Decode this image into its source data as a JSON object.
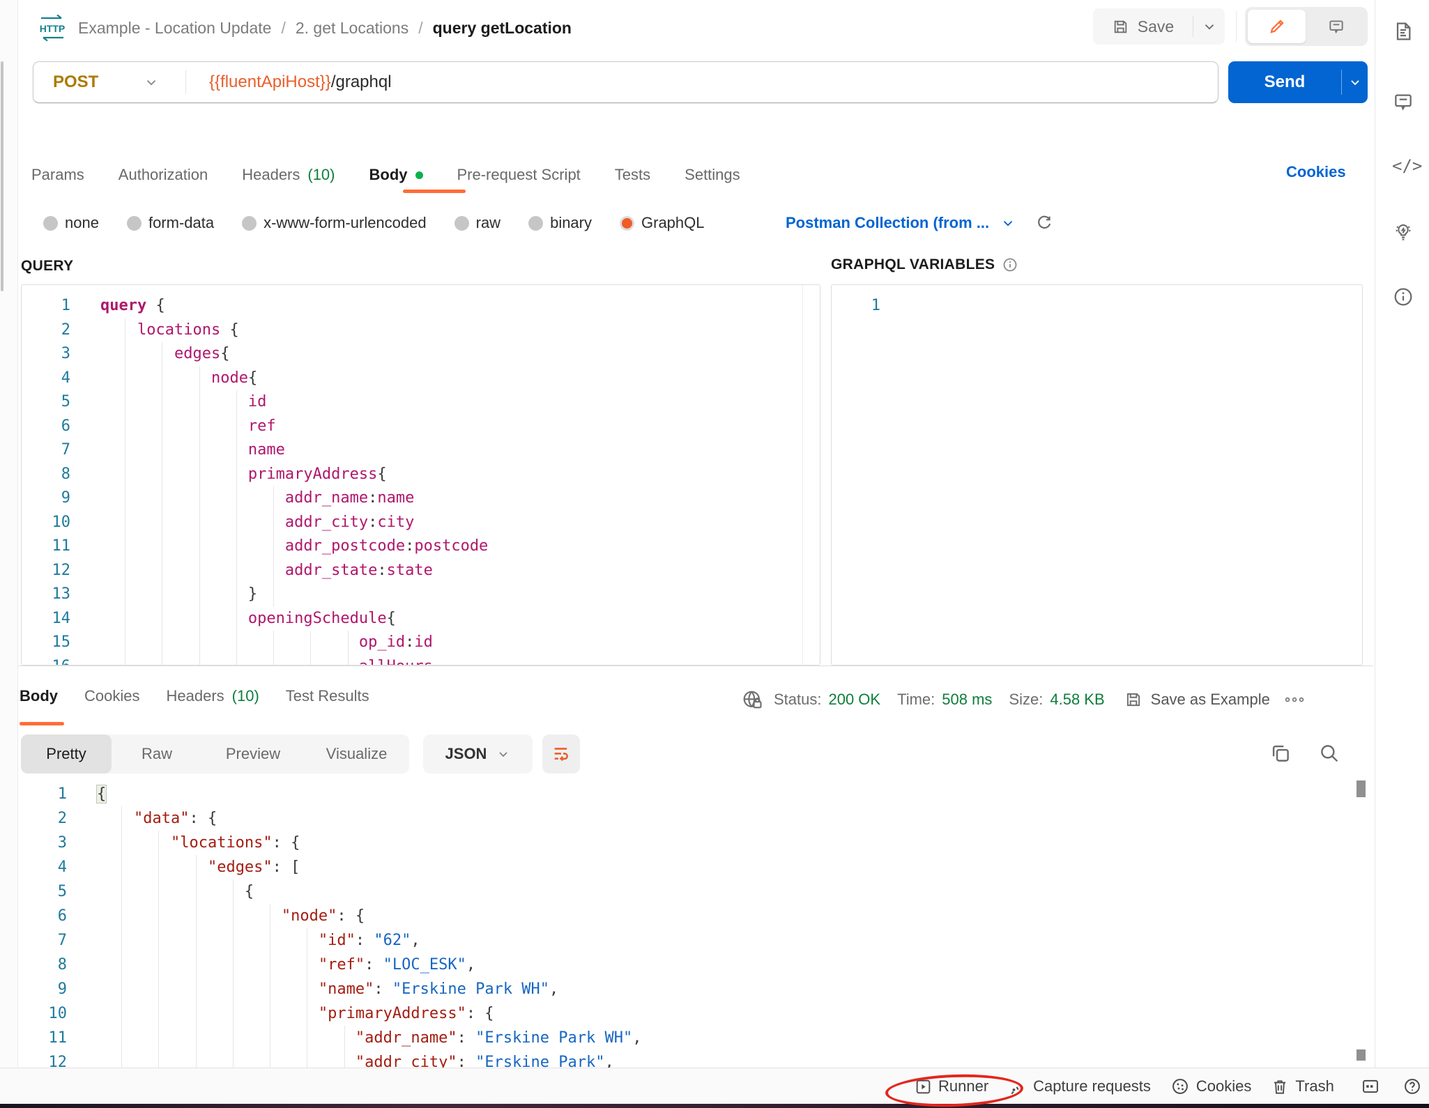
{
  "header": {
    "badge": "HTTP",
    "breadcrumb": [
      "Example - Location Update",
      "2. get Locations",
      "query getLocation"
    ],
    "save": "Save"
  },
  "request": {
    "method": "POST",
    "url_var": "{{fluentApiHost}}",
    "url_path": "/graphql",
    "send": "Send"
  },
  "tabs": {
    "items": [
      {
        "label": "Params"
      },
      {
        "label": "Authorization"
      },
      {
        "label": "Headers",
        "count": "(10)"
      },
      {
        "label": "Body",
        "active": true,
        "dot": true
      },
      {
        "label": "Pre-request Script"
      },
      {
        "label": "Tests"
      },
      {
        "label": "Settings"
      }
    ],
    "cookies": "Cookies"
  },
  "body_modes": {
    "options": [
      "none",
      "form-data",
      "x-www-form-urlencoded",
      "raw",
      "binary",
      "GraphQL"
    ],
    "selected": "GraphQL",
    "schema": "Postman Collection (from ..."
  },
  "query": {
    "label": "QUERY",
    "lines": [
      [
        [
          "kw",
          "query"
        ],
        [
          "pt",
          " {"
        ]
      ],
      [
        [
          "pt",
          "    "
        ],
        [
          "nm",
          "locations"
        ],
        [
          "pt",
          " {"
        ]
      ],
      [
        [
          "pt",
          "        "
        ],
        [
          "nm",
          "edges"
        ],
        [
          "pt",
          "{"
        ]
      ],
      [
        [
          "pt",
          "            "
        ],
        [
          "nm",
          "node"
        ],
        [
          "pt",
          "{"
        ]
      ],
      [
        [
          "pt",
          "                "
        ],
        [
          "nm",
          "id"
        ]
      ],
      [
        [
          "pt",
          "                "
        ],
        [
          "nm",
          "ref"
        ]
      ],
      [
        [
          "pt",
          "                "
        ],
        [
          "nm",
          "name"
        ]
      ],
      [
        [
          "pt",
          "                "
        ],
        [
          "nm",
          "primaryAddress"
        ],
        [
          "pt",
          "{"
        ]
      ],
      [
        [
          "pt",
          "                    "
        ],
        [
          "nm",
          "addr_name"
        ],
        [
          "pt",
          ":"
        ],
        [
          "nm",
          "name"
        ]
      ],
      [
        [
          "pt",
          "                    "
        ],
        [
          "nm",
          "addr_city"
        ],
        [
          "pt",
          ":"
        ],
        [
          "nm",
          "city"
        ]
      ],
      [
        [
          "pt",
          "                    "
        ],
        [
          "nm",
          "addr_postcode"
        ],
        [
          "pt",
          ":"
        ],
        [
          "nm",
          "postcode"
        ]
      ],
      [
        [
          "pt",
          "                    "
        ],
        [
          "nm",
          "addr_state"
        ],
        [
          "pt",
          ":"
        ],
        [
          "nm",
          "state"
        ]
      ],
      [
        [
          "pt",
          "                "
        ],
        [
          "pt",
          "}"
        ]
      ],
      [
        [
          "pt",
          "                "
        ],
        [
          "nm",
          "openingSchedule"
        ],
        [
          "pt",
          "{"
        ]
      ],
      [
        [
          "pt",
          "                            "
        ],
        [
          "nm",
          "op_id"
        ],
        [
          "pt",
          ":"
        ],
        [
          "nm",
          "id"
        ]
      ],
      [
        [
          "pt",
          "                            "
        ],
        [
          "nm",
          "allHours"
        ]
      ]
    ]
  },
  "variables": {
    "label": "GRAPHQL VARIABLES",
    "lines": [
      []
    ]
  },
  "response": {
    "tabs": [
      {
        "label": "Body",
        "active": true
      },
      {
        "label": "Cookies"
      },
      {
        "label": "Headers",
        "count": "(10)"
      },
      {
        "label": "Test Results"
      }
    ],
    "status_label": "Status:",
    "status_value": "200 OK",
    "time_label": "Time:",
    "time_value": "508 ms",
    "size_label": "Size:",
    "size_value": "4.58 KB",
    "save_example": "Save as Example",
    "views": [
      "Pretty",
      "Raw",
      "Preview",
      "Visualize"
    ],
    "active_view": "Pretty",
    "format": "JSON",
    "lines": [
      [
        [
          "hl",
          "{"
        ]
      ],
      [
        [
          "pt",
          "    "
        ],
        [
          "key",
          "\"data\""
        ],
        [
          "pt",
          ": {"
        ]
      ],
      [
        [
          "pt",
          "        "
        ],
        [
          "key",
          "\"locations\""
        ],
        [
          "pt",
          ": {"
        ]
      ],
      [
        [
          "pt",
          "            "
        ],
        [
          "key",
          "\"edges\""
        ],
        [
          "pt",
          ": ["
        ]
      ],
      [
        [
          "pt",
          "                "
        ],
        [
          "pt",
          "{"
        ]
      ],
      [
        [
          "pt",
          "                    "
        ],
        [
          "key",
          "\"node\""
        ],
        [
          "pt",
          ": {"
        ]
      ],
      [
        [
          "pt",
          "                        "
        ],
        [
          "key",
          "\"id\""
        ],
        [
          "pt",
          ": "
        ],
        [
          "str",
          "\"62\""
        ],
        [
          "pt",
          ","
        ]
      ],
      [
        [
          "pt",
          "                        "
        ],
        [
          "key",
          "\"ref\""
        ],
        [
          "pt",
          ": "
        ],
        [
          "str",
          "\"LOC_ESK\""
        ],
        [
          "pt",
          ","
        ]
      ],
      [
        [
          "pt",
          "                        "
        ],
        [
          "key",
          "\"name\""
        ],
        [
          "pt",
          ": "
        ],
        [
          "str",
          "\"Erskine Park WH\""
        ],
        [
          "pt",
          ","
        ]
      ],
      [
        [
          "pt",
          "                        "
        ],
        [
          "key",
          "\"primaryAddress\""
        ],
        [
          "pt",
          ": {"
        ]
      ],
      [
        [
          "pt",
          "                            "
        ],
        [
          "key",
          "\"addr_name\""
        ],
        [
          "pt",
          ": "
        ],
        [
          "str",
          "\"Erskine Park WH\""
        ],
        [
          "pt",
          ","
        ]
      ],
      [
        [
          "pt",
          "                            "
        ],
        [
          "key",
          "\"addr_city\""
        ],
        [
          "pt",
          ": "
        ],
        [
          "str",
          "\"Erskine Park\""
        ],
        [
          "pt",
          ","
        ]
      ]
    ]
  },
  "footer": {
    "items": [
      {
        "icon": "runner",
        "label": "Runner"
      },
      {
        "icon": "capture",
        "label": "Capture requests"
      },
      {
        "icon": "cookie",
        "label": "Cookies"
      },
      {
        "icon": "trash",
        "label": "Trash"
      }
    ]
  },
  "icons": {
    "code_glyph": "</>"
  },
  "colors": {
    "accent_orange": "#ff6c37",
    "link_blue": "#0265d2",
    "success_green": "#0e7e3c",
    "graphql_magenta": "#b0176c",
    "json_key_red": "#a31e12",
    "json_string_blue": "#1766c0",
    "method_post_amber": "#ad7a03",
    "http_teal": "#16808f",
    "annotation_red": "#e3261d"
  }
}
